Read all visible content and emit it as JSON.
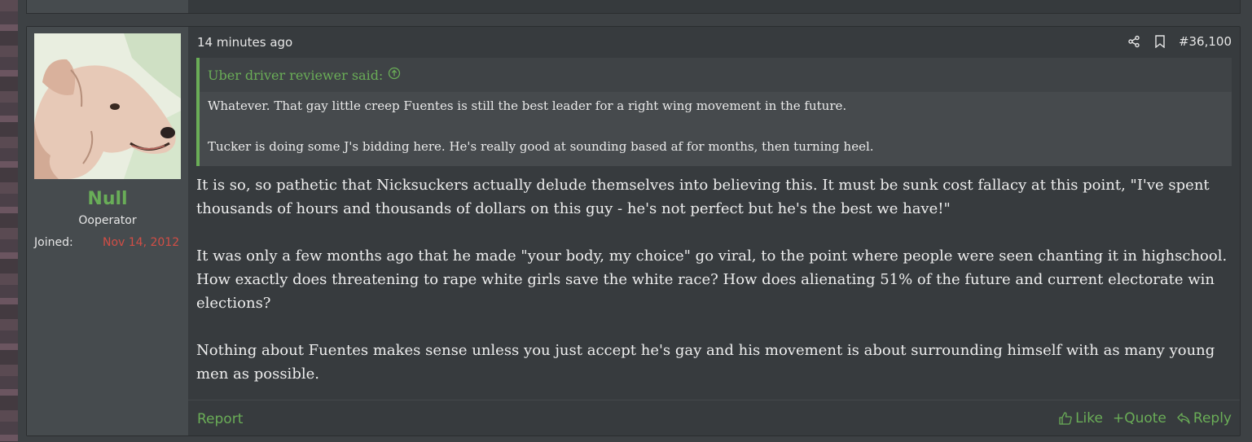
{
  "theme": {
    "accent": "#6aad57",
    "join_date_color": "#d14e46"
  },
  "user": {
    "name": "Null",
    "title": "Ooperator",
    "joined_label": "Joined:",
    "joined_date": "Nov 14, 2012"
  },
  "post": {
    "time": "14 minutes ago",
    "number": "#36,100",
    "quote": {
      "author": "Uber driver reviewer said:",
      "paragraphs": [
        "Whatever. That gay little creep Fuentes is still the best leader for a right wing movement in the future.",
        "Tucker is doing some J's bidding here. He's really good at sounding based af for months, then turning heel."
      ]
    },
    "paragraphs": [
      "It is so, so pathetic that Nicksuckers actually delude themselves into believing this. It must be sunk cost fallacy at this point, \"I've spent thousands of hours and thousands of dollars on this guy - he's not perfect but he's the best we have!\"",
      "It was only a few months ago that he made \"your body, my choice\" go viral, to the point where people were seen chanting it in highschool. How exactly does threatening to rape white girls save the white race? How does alienating 51% of the future and current electorate win elections?",
      "Nothing about Fuentes makes sense unless you just accept he's gay and his movement is about surrounding himself with as many young men as possible."
    ]
  },
  "footer": {
    "report": "Report",
    "like": "Like",
    "quote": "+Quote",
    "reply": "Reply"
  },
  "icons": [
    "share-icon",
    "bookmark-icon",
    "arrow-up-circle-icon",
    "thumbs-up-icon",
    "reply-icon"
  ]
}
